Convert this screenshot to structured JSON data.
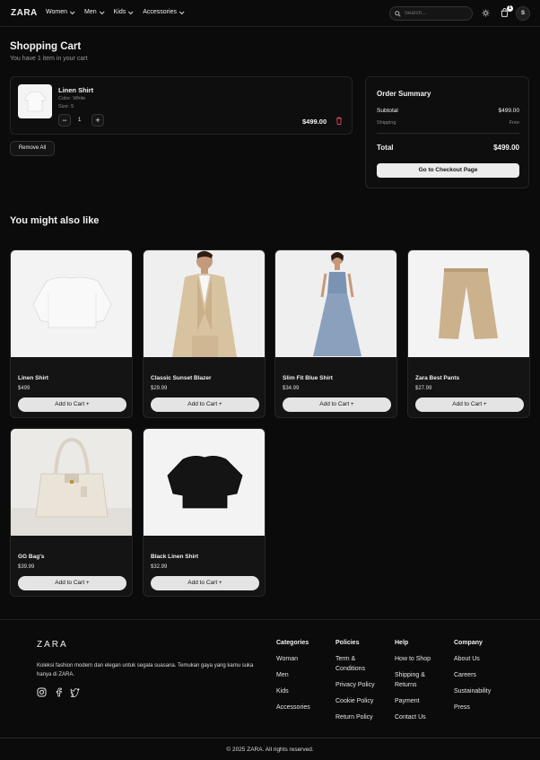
{
  "nav": {
    "logo": "ZARA",
    "menu": [
      "Women",
      "Men",
      "Kids",
      "Accessories"
    ],
    "search_placeholder": "Search...",
    "cart_count": "1",
    "avatar": "S"
  },
  "cart": {
    "title": "Shopping Cart",
    "subtitle": "You have 1 item in your cart",
    "item": {
      "name": "Linen Shirt",
      "color": "Color: White",
      "size": "Size: S",
      "qty": "1",
      "minus": "−",
      "plus": "+",
      "price": "$499.00"
    },
    "remove_all": "Remove All"
  },
  "summary": {
    "title": "Order Summary",
    "subtotal_label": "Subtotal",
    "subtotal": "$499.00",
    "shipping_label": "Shipping",
    "shipping": "Free",
    "total_label": "Total",
    "total": "$499.00",
    "checkout": "Go to Checkout Page"
  },
  "recommend": {
    "title": "You might also like",
    "add_label": "Add to Cart +",
    "products": [
      {
        "name": "Linen Shirt",
        "price": "$499"
      },
      {
        "name": "Classic Sunset Blazer",
        "price": "$29.99"
      },
      {
        "name": "Slim Fit Blue Shirt",
        "price": "$34.99"
      },
      {
        "name": "Zara Best Pants",
        "price": "$27.99"
      },
      {
        "name": "GG Bag's",
        "price": "$39.99"
      },
      {
        "name": "Black Linen Shirt",
        "price": "$32.99"
      }
    ]
  },
  "footer": {
    "logo": "ZARA",
    "description": "Koleksi fashion modern dan elegan untuk segala suasana. Temukan gaya yang kamu suka hanya di ZARA.",
    "columns": [
      {
        "title": "Categories",
        "links": [
          "Woman",
          "Men",
          "Kids",
          "Accessories"
        ]
      },
      {
        "title": "Policies",
        "links": [
          "Term & Conditions",
          "Privacy Policy",
          "Cookie Policy",
          "Return Policy"
        ]
      },
      {
        "title": "Help",
        "links": [
          "How to Shop",
          "Shipping & Returns",
          "Payment",
          "Contact Us"
        ]
      },
      {
        "title": "Company",
        "links": [
          "About Us",
          "Careers",
          "Sustainability",
          "Press"
        ]
      }
    ],
    "copyright": "© 2025 ZARA. All rights reserved."
  }
}
